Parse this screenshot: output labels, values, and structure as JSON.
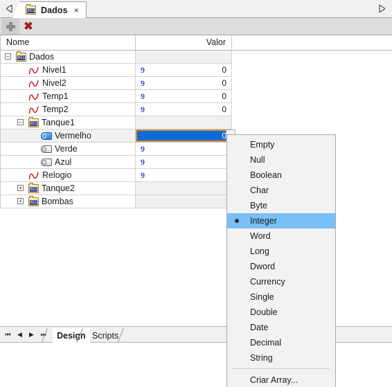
{
  "window": {
    "tab_scroll_left": "left-arrow",
    "tab_scroll_right": "right-arrow"
  },
  "document_tab": {
    "title": "Dados",
    "icon": "binary-folder-icon",
    "icon_text": "011",
    "close": "×"
  },
  "toolbar": {
    "add_label": "+",
    "delete_label": "✖"
  },
  "grid": {
    "columns": [
      "Nome",
      "Valor"
    ],
    "rows": [
      {
        "name": "Dados",
        "indent": 0,
        "icon": "binary-folder-icon",
        "expander": "−",
        "type_glyph": "",
        "value": "",
        "state": "normal"
      },
      {
        "name": "Nivel1",
        "indent": 1,
        "icon": "sine-wave-icon",
        "expander": "",
        "type_glyph": "9",
        "value": "0",
        "state": "normal"
      },
      {
        "name": "Nivel2",
        "indent": 1,
        "icon": "sine-wave-icon",
        "expander": "",
        "type_glyph": "9",
        "value": "0",
        "state": "normal"
      },
      {
        "name": "Temp1",
        "indent": 1,
        "icon": "sine-wave-icon",
        "expander": "",
        "type_glyph": "9",
        "value": "0",
        "state": "normal"
      },
      {
        "name": "Temp2",
        "indent": 1,
        "icon": "sine-wave-icon",
        "expander": "",
        "type_glyph": "9",
        "value": "0",
        "state": "normal"
      },
      {
        "name": "Tanque1",
        "indent": 1,
        "icon": "binary-folder-icon",
        "expander": "−",
        "type_glyph": "",
        "value": "",
        "state": "normal"
      },
      {
        "name": "Vermelho",
        "indent": 2,
        "icon": "tag-icon-blue",
        "expander": "",
        "type_glyph": "9",
        "value": "0",
        "state": "editing"
      },
      {
        "name": "Verde",
        "indent": 2,
        "icon": "tag-icon",
        "expander": "",
        "type_glyph": "9",
        "value": "",
        "state": "normal"
      },
      {
        "name": "Azul",
        "indent": 2,
        "icon": "tag-icon",
        "expander": "",
        "type_glyph": "9",
        "value": "",
        "state": "normal"
      },
      {
        "name": "Relogio",
        "indent": 1,
        "icon": "sine-wave-icon",
        "expander": "",
        "type_glyph": "9",
        "value": "",
        "state": "normal"
      },
      {
        "name": "Tanque2",
        "indent": 1,
        "icon": "binary-folder-icon",
        "expander": "+",
        "type_glyph": "",
        "value": "",
        "state": "normal"
      },
      {
        "name": "Bombas",
        "indent": 1,
        "icon": "binary-folder-icon",
        "expander": "+",
        "type_glyph": "",
        "value": "",
        "state": "normal"
      }
    ]
  },
  "context_menu": {
    "selected": "Integer",
    "items": [
      {
        "label": "Empty",
        "selected": false,
        "separator_before": false
      },
      {
        "label": "Null",
        "selected": false,
        "separator_before": false
      },
      {
        "label": "Boolean",
        "selected": false,
        "separator_before": false
      },
      {
        "label": "Char",
        "selected": false,
        "separator_before": false
      },
      {
        "label": "Byte",
        "selected": false,
        "separator_before": false
      },
      {
        "label": "Integer",
        "selected": true,
        "separator_before": false
      },
      {
        "label": "Word",
        "selected": false,
        "separator_before": false
      },
      {
        "label": "Long",
        "selected": false,
        "separator_before": false
      },
      {
        "label": "Dword",
        "selected": false,
        "separator_before": false
      },
      {
        "label": "Currency",
        "selected": false,
        "separator_before": false
      },
      {
        "label": "Single",
        "selected": false,
        "separator_before": false
      },
      {
        "label": "Double",
        "selected": false,
        "separator_before": false
      },
      {
        "label": "Date",
        "selected": false,
        "separator_before": false
      },
      {
        "label": "Decimal",
        "selected": false,
        "separator_before": false
      },
      {
        "label": "String",
        "selected": false,
        "separator_before": false
      },
      {
        "label": "Criar Array...",
        "selected": false,
        "separator_before": true
      }
    ]
  },
  "bottom_bar": {
    "nav": [
      "⏮",
      "◀",
      "▶",
      "⏭"
    ],
    "tabs": [
      {
        "label": "Design",
        "active": true
      },
      {
        "label": "Scripts",
        "active": false
      }
    ]
  },
  "colors": {
    "selection_blue": "#0a6cd8",
    "edit_border_orange": "#e08a2e",
    "menu_highlight": "#78c0f5",
    "type_glyph_blue": "#3b49d6",
    "toolbar_bg": "#dedede"
  }
}
